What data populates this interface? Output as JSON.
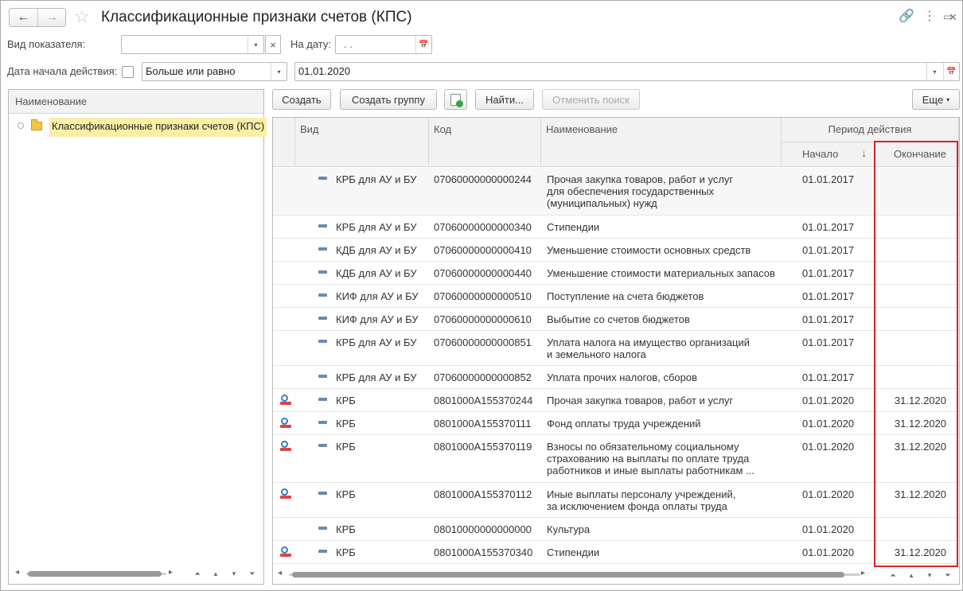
{
  "window": {
    "title": "Классификационные признаки счетов (КПС)",
    "nav_back_icon": "←",
    "nav_forward_icon": "→",
    "star_icon": "☆",
    "link_icon": "🔗",
    "menu_icon": "⋮",
    "maximize_icon": "▭",
    "close_icon": "✕"
  },
  "filters": {
    "indicator_label": "Вид показателя:",
    "indicator_value": "",
    "date_label": "На дату:",
    "date_value": " .  .",
    "start_label": "Дата начала действия:",
    "condition_value": "Больше или равно",
    "start_date_value": "01.01.2020",
    "clear_icon": "×",
    "dropdown_icon": "▾",
    "calendar_icon": "📅"
  },
  "left_panel": {
    "header": "Наименование",
    "tree_item": "Классификационные признаки счетов (КПС)"
  },
  "toolbar": {
    "create": "Создать",
    "create_group": "Создать группу",
    "find": "Найти...",
    "cancel_search": "Отменить поиск",
    "more": "Еще"
  },
  "table": {
    "headers": {
      "kind": "Вид",
      "code": "Код",
      "name": "Наименование",
      "period": "Период действия",
      "start": "Начало",
      "end": "Окончание",
      "sort_icon": "↓"
    },
    "rows": [
      {
        "icon": false,
        "kind": "КРБ для АУ и БУ",
        "code": "07060000000000244",
        "name": [
          "Прочая закупка товаров, работ и услуг",
          "для обеспечения государственных",
          "(муниципальных) нужд"
        ],
        "start": "01.01.2017",
        "end": ""
      },
      {
        "icon": false,
        "kind": "КРБ для АУ и БУ",
        "code": "07060000000000340",
        "name": [
          "Стипендии"
        ],
        "start": "01.01.2017",
        "end": ""
      },
      {
        "icon": false,
        "kind": "КДБ для АУ и БУ",
        "code": "07060000000000410",
        "name": [
          "Уменьшение стоимости основных средств"
        ],
        "start": "01.01.2017",
        "end": ""
      },
      {
        "icon": false,
        "kind": "КДБ для АУ и БУ",
        "code": "07060000000000440",
        "name": [
          "Уменьшение стоимости материальных запасов"
        ],
        "start": "01.01.2017",
        "end": ""
      },
      {
        "icon": false,
        "kind": "КИФ для АУ и БУ",
        "code": "07060000000000510",
        "name": [
          "Поступление на счета бюджетов"
        ],
        "start": "01.01.2017",
        "end": ""
      },
      {
        "icon": false,
        "kind": "КИФ для АУ и БУ",
        "code": "07060000000000610",
        "name": [
          "Выбытие со счетов бюджетов"
        ],
        "start": "01.01.2017",
        "end": ""
      },
      {
        "icon": false,
        "kind": "КРБ для АУ и БУ",
        "code": "07060000000000851",
        "name": [
          "Уплата налога на имущество организаций",
          "и земельного налога"
        ],
        "start": "01.01.2017",
        "end": ""
      },
      {
        "icon": false,
        "kind": "КРБ для АУ и БУ",
        "code": "07060000000000852",
        "name": [
          "Уплата прочих налогов, сборов"
        ],
        "start": "01.01.2017",
        "end": ""
      },
      {
        "icon": true,
        "kind": "КРБ",
        "code": "0801000А155370244",
        "name": [
          "Прочая закупка товаров, работ и услуг"
        ],
        "start": "01.01.2020",
        "end": "31.12.2020"
      },
      {
        "icon": true,
        "kind": "КРБ",
        "code": "0801000А155370111",
        "name": [
          "Фонд оплаты труда учреждений"
        ],
        "start": "01.01.2020",
        "end": "31.12.2020"
      },
      {
        "icon": true,
        "kind": "КРБ",
        "code": "0801000А155370119",
        "name": [
          "Взносы по обязательному социальному",
          "страхованию на выплаты по оплате труда",
          "работников и иные выплаты работникам ..."
        ],
        "start": "01.01.2020",
        "end": "31.12.2020"
      },
      {
        "icon": true,
        "kind": "КРБ",
        "code": "0801000А155370112",
        "name": [
          "Иные выплаты персоналу учреждений,",
          "за исключением фонда оплаты труда"
        ],
        "start": "01.01.2020",
        "end": "31.12.2020"
      },
      {
        "icon": false,
        "kind": "КРБ",
        "code": "08010000000000000",
        "name": [
          "Культура"
        ],
        "start": "01.01.2020",
        "end": ""
      },
      {
        "icon": true,
        "kind": "КРБ",
        "code": "0801000А155370340",
        "name": [
          "Стипендии"
        ],
        "start": "01.01.2020",
        "end": "31.12.2020"
      }
    ]
  },
  "scroll_icons": {
    "left": "◂",
    "right": "▸",
    "first": "⏶",
    "up": "▴",
    "down": "▾",
    "last": "⏷"
  }
}
